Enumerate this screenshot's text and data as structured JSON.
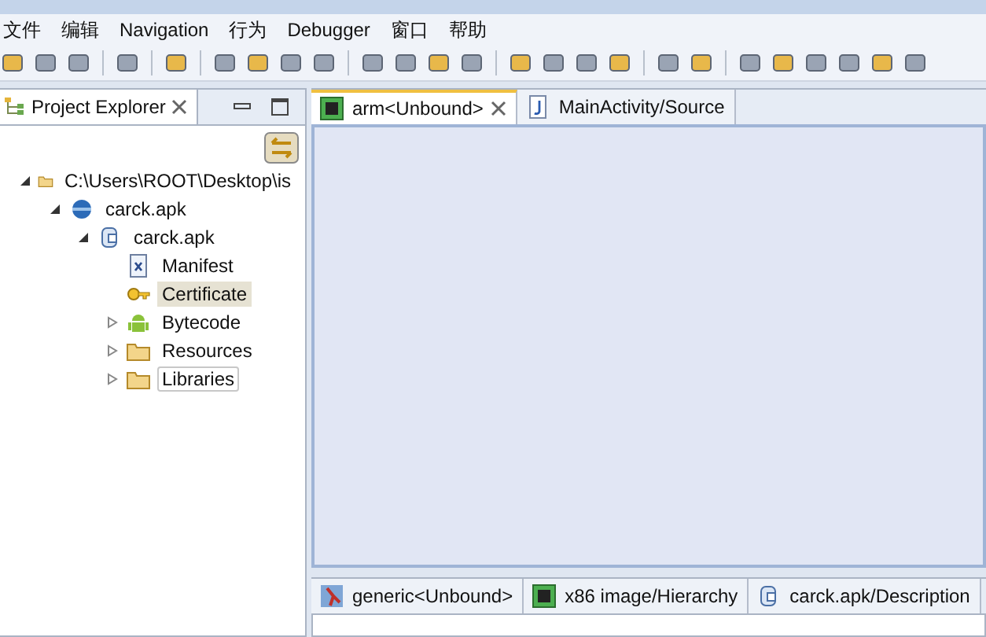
{
  "menu": [
    "文件",
    "编辑",
    "Navigation",
    "行为",
    "Debugger",
    "窗口",
    "帮助"
  ],
  "explorer": {
    "title": "Project Explorer",
    "tree": [
      {
        "label": "C:\\Users\\ROOT\\Desktop\\is",
        "kind": "folder",
        "expanded": true,
        "selected": false,
        "focused": false,
        "children": [
          {
            "label": "carck.apk",
            "kind": "artifact",
            "expanded": true,
            "selected": false,
            "focused": false,
            "children": [
              {
                "label": "carck.apk",
                "kind": "apk",
                "expanded": true,
                "selected": false,
                "focused": false,
                "children": [
                  {
                    "label": "Manifest",
                    "kind": "xml",
                    "selected": false,
                    "focused": false
                  },
                  {
                    "label": "Certificate",
                    "kind": "key",
                    "selected": true,
                    "focused": false
                  },
                  {
                    "label": "Bytecode",
                    "kind": "android",
                    "expanded": false,
                    "selected": false,
                    "focused": false
                  },
                  {
                    "label": "Resources",
                    "kind": "folder",
                    "expanded": false,
                    "selected": false,
                    "focused": false
                  },
                  {
                    "label": "Libraries",
                    "kind": "folder",
                    "expanded": false,
                    "selected": false,
                    "focused": true
                  }
                ]
              }
            ]
          }
        ]
      }
    ]
  },
  "editor_tabs": [
    {
      "label": "arm<Unbound>",
      "kind": "chip",
      "selected": true
    },
    {
      "label": "MainActivity/Source",
      "kind": "source",
      "selected": false
    }
  ],
  "bottom_tabs": [
    {
      "label": "generic<Unbound>",
      "kind": "generic",
      "selected": false
    },
    {
      "label": "x86 image/Hierarchy",
      "kind": "chip",
      "selected": false
    },
    {
      "label": "carck.apk/Description",
      "kind": "apk",
      "selected": false
    }
  ]
}
